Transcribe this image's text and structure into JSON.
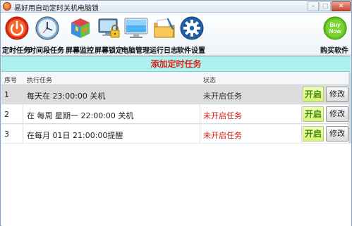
{
  "window": {
    "title": "易好用自动定时关机电脑锁"
  },
  "toolbar": {
    "items": [
      {
        "label": "定时任务",
        "icon": "power-icon"
      },
      {
        "label": "时间段任务",
        "icon": "clock-icon"
      },
      {
        "label": "屏幕监控",
        "icon": "cube-icon"
      },
      {
        "label": "屏幕锁定",
        "icon": "monitor-lock-icon"
      },
      {
        "label": "电脑管理",
        "icon": "monitor-icon"
      },
      {
        "label": "运行日志",
        "icon": "folder-log-icon"
      },
      {
        "label": "软件设置",
        "icon": "gear-icon"
      }
    ],
    "buy": {
      "label": "购买软件",
      "badge_top": "Buy",
      "badge_bottom": "Now"
    }
  },
  "banner": {
    "text": "添加定时任务"
  },
  "table": {
    "headers": {
      "num": "序号",
      "task": "执行任务",
      "status": "状态"
    },
    "rows": [
      {
        "num": "1",
        "task": "每天在 23:00:00 关机",
        "status": "未开启任务",
        "open": "开启",
        "edit": "修改",
        "selected": true
      },
      {
        "num": "2",
        "task": "在 每周 星期一 22:00:00 关机",
        "status": "未开启任务",
        "open": "开启",
        "edit": "修改",
        "selected": false
      },
      {
        "num": "3",
        "task": "在每月 01日 21:00:00提醒",
        "status": "未开启任务",
        "open": "开启",
        "edit": "修改",
        "selected": false
      }
    ]
  },
  "colors": {
    "banner_bg": "#aef0ee",
    "banner_text": "#d6241a",
    "status_text": "#d01a10",
    "open_text": "#3f8a00",
    "selected_row": "#dcdcdc"
  }
}
